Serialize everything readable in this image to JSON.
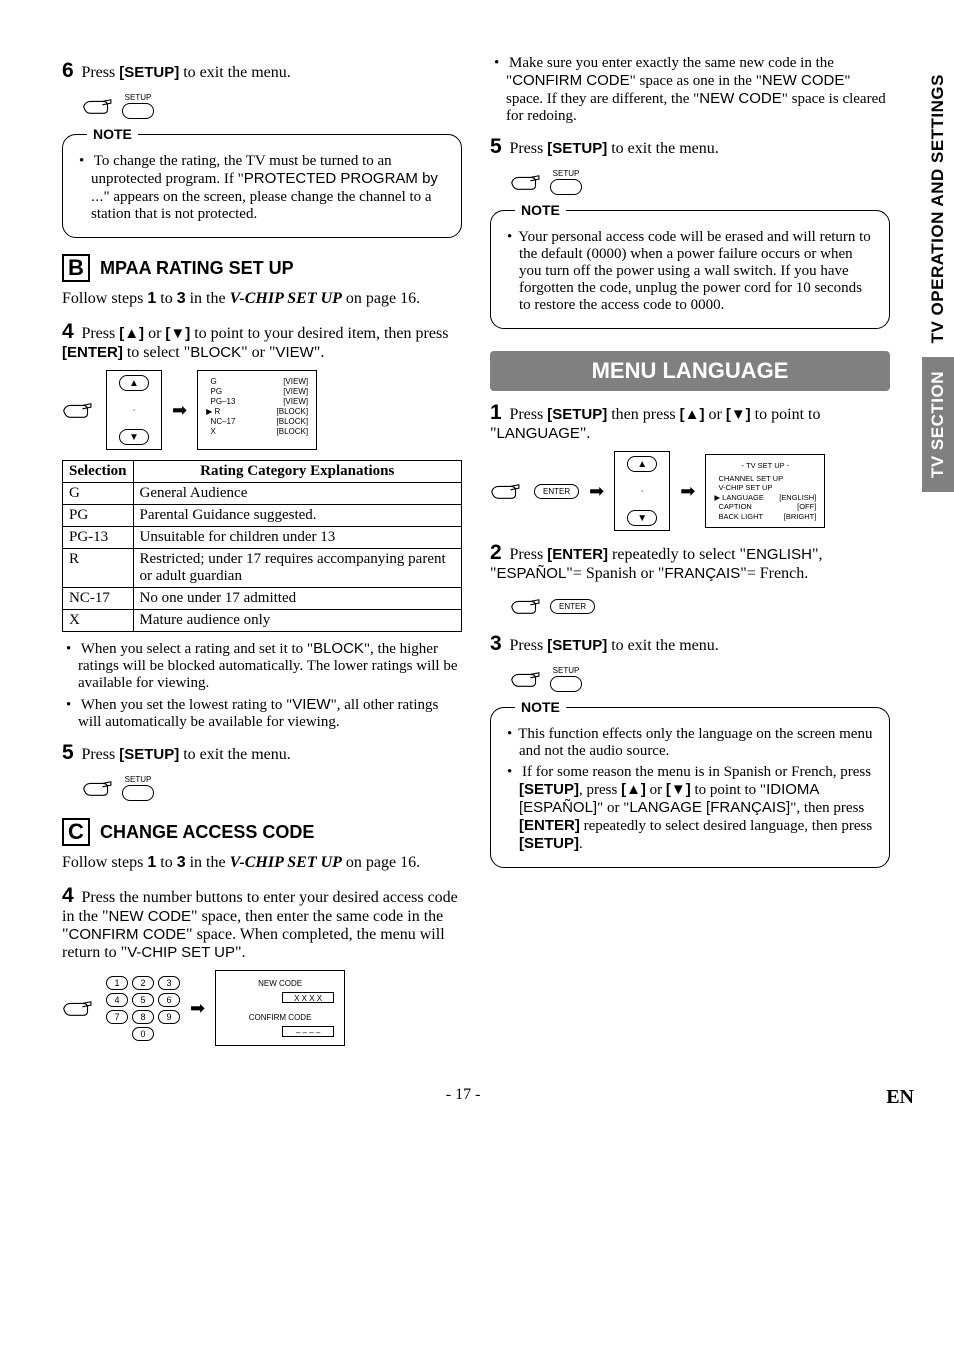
{
  "sidebar": {
    "top": "TV OPERATION AND SETTINGS",
    "bottom": "TV SECTION"
  },
  "left": {
    "step6": {
      "num": "6",
      "lead": "Press ",
      "btn": "[SETUP]",
      "tail": " to exit the menu.",
      "setup_label": "SETUP"
    },
    "noteA": {
      "title": "NOTE",
      "line1a": "To change the rating, the TV must be turned to an unprotected program. If \"",
      "line1b": "PROTECTED PROGRAM by ...",
      "line1c": "\" appears on the screen, please change the channel to a station that is not protected."
    },
    "sectionB": {
      "letter": "B",
      "title": "MPAA RATING SET UP",
      "follow_a": "Follow steps ",
      "follow_1": "1",
      "follow_b": " to ",
      "follow_3": "3",
      "follow_c": " in the ",
      "follow_ref": "V-CHIP SET UP",
      "follow_d": " on page 16."
    },
    "step4B": {
      "num": "4",
      "a": "Press ",
      "up": "[▲]",
      "b": " or ",
      "down": "[▼]",
      "c": " to point to your desired item, then press ",
      "enter": "[ENTER]",
      "d": " to select \"",
      "block": "BLOCK",
      "e": "\" or \"",
      "view": "VIEW",
      "f": "\"."
    },
    "mpaa_osd": {
      "rows": [
        [
          "G",
          "[VIEW]"
        ],
        [
          "PG",
          "[VIEW]"
        ],
        [
          "PG–13",
          "[VIEW]"
        ],
        [
          "R",
          "[BLOCK]"
        ],
        [
          "NC–17",
          "[BLOCK]"
        ],
        [
          "X",
          "[BLOCK]"
        ]
      ],
      "cursor_row": 3
    },
    "table": {
      "h1": "Selection",
      "h2": "Rating Category Explanations",
      "rows": [
        [
          "G",
          "General Audience"
        ],
        [
          "PG",
          "Parental Guidance suggested."
        ],
        [
          "PG-13",
          "Unsuitable for children under 13"
        ],
        [
          "R",
          "Restricted; under 17 requires accompanying parent or adult guardian"
        ],
        [
          "NC-17",
          "No one under 17 admitted"
        ],
        [
          "X",
          "Mature audience only"
        ]
      ]
    },
    "bulletsB": {
      "l1a": "When you select a rating and set it to \"",
      "l1b": "BLOCK",
      "l1c": "\", the higher ratings will be blocked automatically. The lower ratings will be available for viewing.",
      "l2a": "When you set the lowest rating to \"",
      "l2b": "VIEW",
      "l2c": "\", all other ratings will automatically be available for viewing."
    },
    "step5B": {
      "num": "5",
      "lead": "Press ",
      "btn": "[SETUP]",
      "tail": " to exit the menu.",
      "setup_label": "SETUP"
    },
    "sectionC": {
      "letter": "C",
      "title": "CHANGE ACCESS CODE",
      "follow_a": "Follow steps ",
      "follow_1": "1",
      "follow_b": " to ",
      "follow_3": "3",
      "follow_c": " in the ",
      "follow_ref": "V-CHIP SET UP",
      "follow_d": " on page 16."
    },
    "step4C": {
      "num": "4",
      "a": "Press the number buttons to enter your desired access code in the \"",
      "new": "NEW CODE",
      "b": "\" space, then enter the same code in the \"",
      "conf": "CONFIRM CODE",
      "c": "\" space. When completed, the menu will return to \"",
      "vchip": "V-CHIP SET UP",
      "d": "\"."
    },
    "keypad": [
      "1",
      "2",
      "3",
      "4",
      "5",
      "6",
      "7",
      "8",
      "9",
      "0"
    ],
    "code_screen": {
      "new_label": "NEW CODE",
      "new_val": "X X X X",
      "conf_label": "CONFIRM CODE",
      "conf_val": "– – – –"
    }
  },
  "right": {
    "bullet_top": {
      "a": "Make sure you enter exactly the same new code in the \"",
      "conf": "CONFIRM CODE",
      "b": "\" space as one in the \"",
      "new": "NEW CODE",
      "c": "\" space. If they are different, the \"",
      "new2": "NEW CODE",
      "d": "\" space is cleared for redoing."
    },
    "step5C": {
      "num": "5",
      "lead": "Press ",
      "btn": "[SETUP]",
      "tail": " to exit the menu.",
      "setup_label": "SETUP"
    },
    "noteC": {
      "title": "NOTE",
      "text": "Your personal access code will be erased and will return to the default (0000) when a power failure occurs or when you turn off the power using a wall switch. If you have forgotten the code, unplug the power cord for 10 seconds to restore the access code to 0000."
    },
    "banner": "MENU LANGUAGE",
    "step1": {
      "num": "1",
      "a": "Press ",
      "setup": "[SETUP]",
      "b": " then press ",
      "up": "[▲]",
      "c": " or ",
      "down": "[▼]",
      "d": " to point to \"",
      "lang": "LANGUAGE",
      "e": "\"."
    },
    "enter_label": "ENTER",
    "osd_tv": {
      "title": "- TV SET UP -",
      "rows": [
        [
          "CHANNEL SET UP",
          ""
        ],
        [
          "V-CHIP SET UP",
          ""
        ],
        [
          "LANGUAGE",
          "[ENGLISH]"
        ],
        [
          "CAPTION",
          "[OFF]"
        ],
        [
          "BACK LIGHT",
          "[BRIGHT]"
        ]
      ],
      "cursor_row": 2
    },
    "step2": {
      "num": "2",
      "a": "Press ",
      "enter": "[ENTER]",
      "b": " repeatedly to select \"",
      "eng": "ENGLISH",
      "c": "\", \"",
      "esp": "ESPAÑOL",
      "d": "\"= Spanish or \"",
      "fra": "FRANÇAIS",
      "e": "\"= French."
    },
    "step3": {
      "num": "3",
      "lead": "Press ",
      "btn": "[SETUP]",
      "tail": " to exit the menu.",
      "setup_label": "SETUP"
    },
    "noteLang": {
      "title": "NOTE",
      "l1": "This function effects only the language on the screen menu and not the audio source.",
      "l2a": "If for some reason the menu is in Spanish or French, press ",
      "l2setup": "[SETUP]",
      "l2b": ", press ",
      "l2up": "[▲]",
      "l2c": " or ",
      "l2down": "[▼]",
      "l2d": " to point to \"",
      "l2idioma": "IDIOMA [ESPAÑOL]",
      "l2e": "\" or \"",
      "l2langage": "LANGAGE [FRANÇAIS]",
      "l2f": "\", then press ",
      "l2enter": "[ENTER]",
      "l2g": " repeatedly to select desired language, then press ",
      "l2setup2": "[SETUP]",
      "l2h": "."
    }
  },
  "footer": {
    "page": "- 17 -",
    "lang": "EN"
  }
}
